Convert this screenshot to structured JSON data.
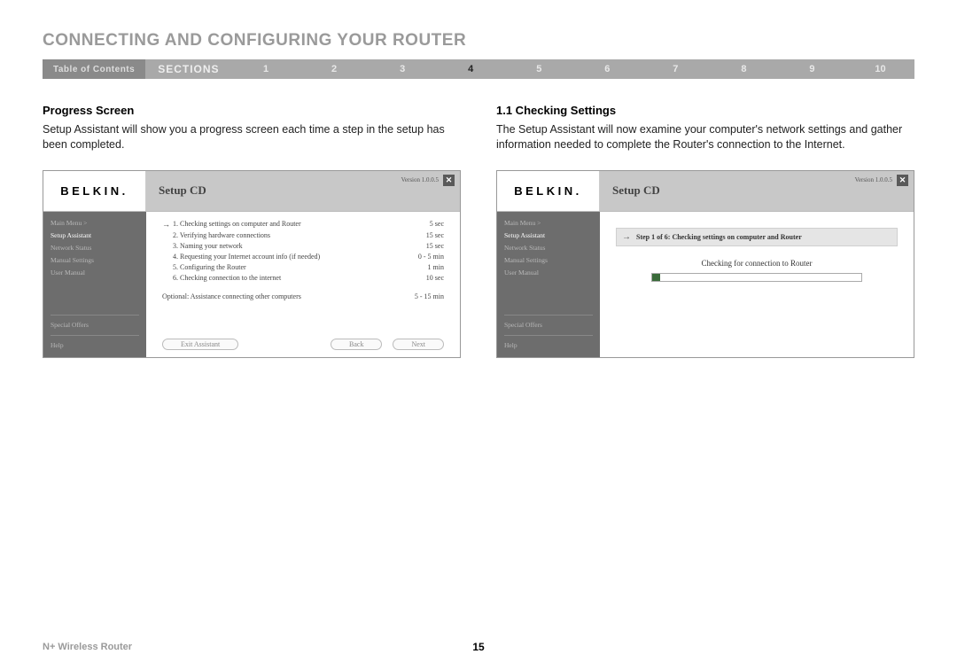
{
  "title": "CONNECTING AND CONFIGURING YOUR ROUTER",
  "nav": {
    "toc": "Table of Contents",
    "sections": "SECTIONS",
    "numbers": [
      "1",
      "2",
      "3",
      "4",
      "5",
      "6",
      "7",
      "8",
      "9",
      "10"
    ],
    "active_index": 3
  },
  "left": {
    "heading": "Progress Screen",
    "body": "Setup Assistant will show you a progress screen each time a step in the setup has been completed.",
    "shot": {
      "logo": "BELKIN.",
      "title": "Setup CD",
      "version": "Version 1.0.0.5",
      "close": "✕",
      "side": {
        "items": [
          "Main Menu  >",
          "Setup Assistant",
          "Network Status",
          "Manual Settings",
          "User Manual"
        ],
        "special": "Special Offers",
        "help": "Help",
        "active_index": 1
      },
      "steps": [
        {
          "n": "1.",
          "label": "Checking settings on computer and Router",
          "time": "5 sec",
          "active": true
        },
        {
          "n": "2.",
          "label": "Verifying hardware connections",
          "time": "15 sec",
          "active": false
        },
        {
          "n": "3.",
          "label": "Naming your network",
          "time": "15 sec",
          "active": false
        },
        {
          "n": "4.",
          "label": "Requesting your Internet account info (if needed)",
          "time": "0 - 5 min",
          "active": false
        },
        {
          "n": "5.",
          "label": "Configuring the Router",
          "time": "1 min",
          "active": false
        },
        {
          "n": "6.",
          "label": "Checking connection to the internet",
          "time": "10 sec",
          "active": false
        }
      ],
      "optional": {
        "label": "Optional: Assistance connecting other computers",
        "time": "5 - 15 min"
      },
      "buttons": {
        "exit": "Exit Assistant",
        "back": "Back",
        "next": "Next"
      }
    }
  },
  "right": {
    "heading": "1.1 Checking Settings",
    "body": "The Setup Assistant will now examine your computer's network settings and gather information needed to complete the Router's connection to the Internet.",
    "shot": {
      "logo": "BELKIN.",
      "title": "Setup CD",
      "version": "Version 1.0.0.5",
      "close": "✕",
      "side": {
        "items": [
          "Main Menu  >",
          "Setup Assistant",
          "Network Status",
          "Manual Settings",
          "User Manual"
        ],
        "special": "Special Offers",
        "help": "Help",
        "active_index": 1
      },
      "banner_arrow": "→",
      "banner": "Step 1 of 6: Checking settings on computer and Router",
      "checking": "Checking for connection to Router"
    }
  },
  "footer": {
    "product": "N+ Wireless Router",
    "page": "15"
  }
}
